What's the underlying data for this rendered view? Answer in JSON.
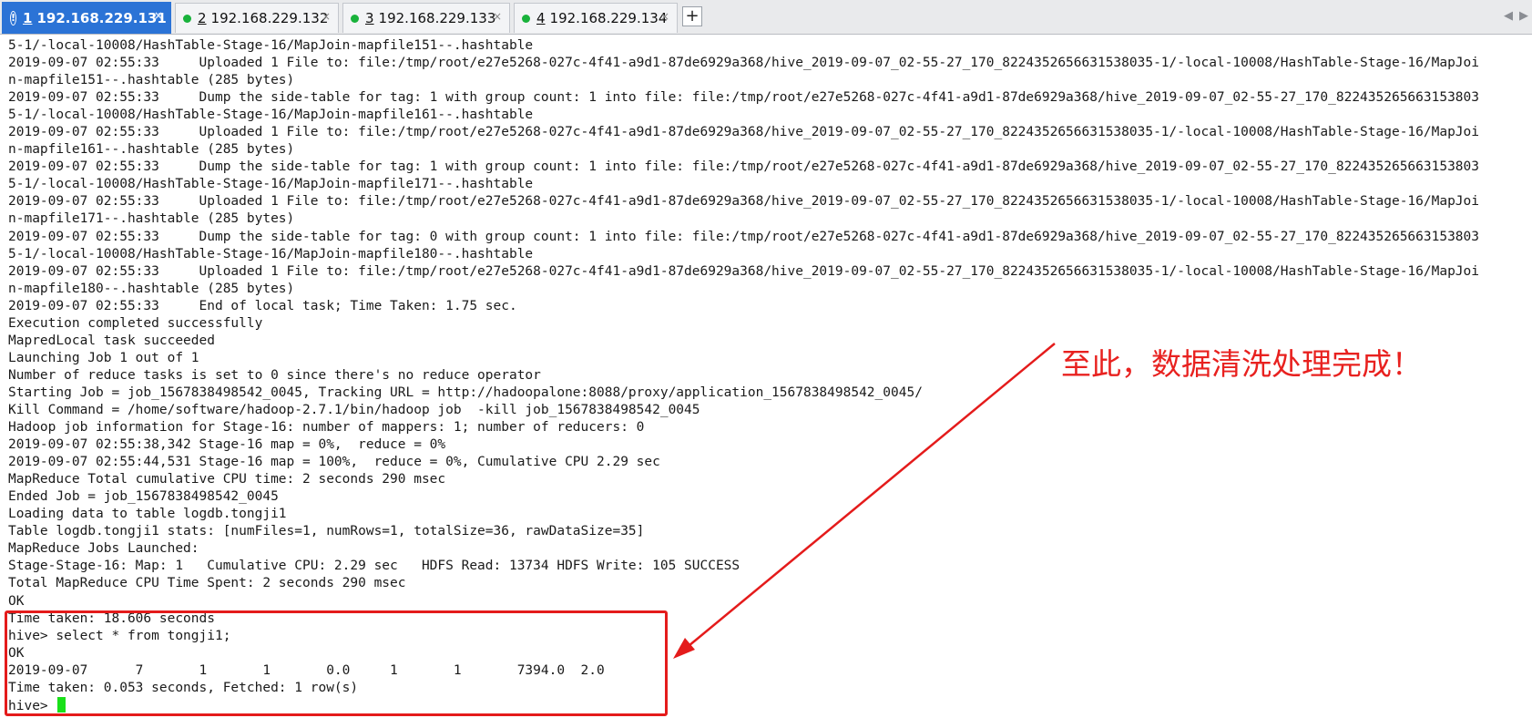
{
  "tabs": [
    {
      "num": "1",
      "host": "192.168.229.131",
      "status": "warning",
      "active": true
    },
    {
      "num": "2",
      "host": "192.168.229.132",
      "status": "connected",
      "active": false
    },
    {
      "num": "3",
      "host": "192.168.229.133",
      "status": "connected",
      "active": false
    },
    {
      "num": "4",
      "host": "192.168.229.134",
      "status": "connected",
      "active": false
    }
  ],
  "icons": {
    "warning": "exclamation-circle-icon",
    "connected": "green-dot-icon",
    "close": "close-icon",
    "add": "plus-icon",
    "scroll_left": "chevron-left-icon",
    "scroll_right": "chevron-right-icon"
  },
  "tabbar": {
    "close_glyph": "×",
    "add_glyph": "+",
    "left_glyph": "◀",
    "right_glyph": "▶"
  },
  "terminal": {
    "lines": [
      "5-1/-local-10008/HashTable-Stage-16/MapJoin-mapfile151--.hashtable",
      "2019-09-07 02:55:33     Uploaded 1 File to: file:/tmp/root/e27e5268-027c-4f41-a9d1-87de6929a368/hive_2019-09-07_02-55-27_170_8224352656631538035-1/-local-10008/HashTable-Stage-16/MapJoi",
      "n-mapfile151--.hashtable (285 bytes)",
      "2019-09-07 02:55:33     Dump the side-table for tag: 1 with group count: 1 into file: file:/tmp/root/e27e5268-027c-4f41-a9d1-87de6929a368/hive_2019-09-07_02-55-27_170_822435265663153803",
      "5-1/-local-10008/HashTable-Stage-16/MapJoin-mapfile161--.hashtable",
      "2019-09-07 02:55:33     Uploaded 1 File to: file:/tmp/root/e27e5268-027c-4f41-a9d1-87de6929a368/hive_2019-09-07_02-55-27_170_8224352656631538035-1/-local-10008/HashTable-Stage-16/MapJoi",
      "n-mapfile161--.hashtable (285 bytes)",
      "2019-09-07 02:55:33     Dump the side-table for tag: 1 with group count: 1 into file: file:/tmp/root/e27e5268-027c-4f41-a9d1-87de6929a368/hive_2019-09-07_02-55-27_170_822435265663153803",
      "5-1/-local-10008/HashTable-Stage-16/MapJoin-mapfile171--.hashtable",
      "2019-09-07 02:55:33     Uploaded 1 File to: file:/tmp/root/e27e5268-027c-4f41-a9d1-87de6929a368/hive_2019-09-07_02-55-27_170_8224352656631538035-1/-local-10008/HashTable-Stage-16/MapJoi",
      "n-mapfile171--.hashtable (285 bytes)",
      "2019-09-07 02:55:33     Dump the side-table for tag: 0 with group count: 1 into file: file:/tmp/root/e27e5268-027c-4f41-a9d1-87de6929a368/hive_2019-09-07_02-55-27_170_822435265663153803",
      "5-1/-local-10008/HashTable-Stage-16/MapJoin-mapfile180--.hashtable",
      "2019-09-07 02:55:33     Uploaded 1 File to: file:/tmp/root/e27e5268-027c-4f41-a9d1-87de6929a368/hive_2019-09-07_02-55-27_170_8224352656631538035-1/-local-10008/HashTable-Stage-16/MapJoi",
      "n-mapfile180--.hashtable (285 bytes)",
      "2019-09-07 02:55:33     End of local task; Time Taken: 1.75 sec.",
      "Execution completed successfully",
      "MapredLocal task succeeded",
      "Launching Job 1 out of 1",
      "Number of reduce tasks is set to 0 since there's no reduce operator",
      "Starting Job = job_1567838498542_0045, Tracking URL = http://hadoopalone:8088/proxy/application_1567838498542_0045/",
      "Kill Command = /home/software/hadoop-2.7.1/bin/hadoop job  -kill job_1567838498542_0045",
      "Hadoop job information for Stage-16: number of mappers: 1; number of reducers: 0",
      "2019-09-07 02:55:38,342 Stage-16 map = 0%,  reduce = 0%",
      "2019-09-07 02:55:44,531 Stage-16 map = 100%,  reduce = 0%, Cumulative CPU 2.29 sec",
      "MapReduce Total cumulative CPU time: 2 seconds 290 msec",
      "Ended Job = job_1567838498542_0045",
      "Loading data to table logdb.tongji1",
      "Table logdb.tongji1 stats: [numFiles=1, numRows=1, totalSize=36, rawDataSize=35]",
      "MapReduce Jobs Launched:",
      "Stage-Stage-16: Map: 1   Cumulative CPU: 2.29 sec   HDFS Read: 13734 HDFS Write: 105 SUCCESS",
      "Total MapReduce CPU Time Spent: 2 seconds 290 msec",
      "OK",
      "Time taken: 18.606 seconds",
      "hive> select * from tongji1;",
      "OK",
      "2019-09-07      7       1       1       0.0     1       1       7394.0  2.0",
      "Time taken: 0.053 seconds, Fetched: 1 row(s)",
      "hive> "
    ]
  },
  "annotation": {
    "text": "至此，数据清洗处理完成！",
    "color": "#e8211f"
  },
  "colors": {
    "active_tab": "#2b73d6",
    "connected_dot": "#19b23b",
    "cursor": "#19e019",
    "annotation": "#e41b1b"
  }
}
